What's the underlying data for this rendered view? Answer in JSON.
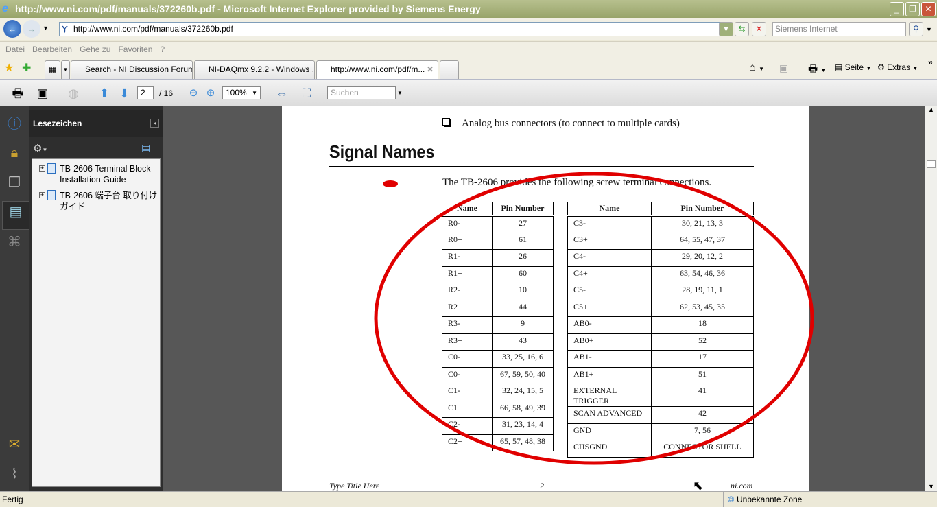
{
  "window": {
    "title": "http://www.ni.com/pdf/manuals/372260b.pdf - Microsoft Internet Explorer provided by Siemens Energy"
  },
  "address": {
    "url": "http://www.ni.com/pdf/manuals/372260b.pdf",
    "search_placeholder": "Siemens Internet"
  },
  "menu": [
    "Datei",
    "Bearbeiten",
    "Gehe zu",
    "Favoriten",
    "?"
  ],
  "tabs": [
    {
      "label": "Search - NI Discussion Forums"
    },
    {
      "label": "NI-DAQmx 9.2.2 - Windows ..."
    },
    {
      "label": "http://www.ni.com/pdf/m..."
    }
  ],
  "ie_toolbar": {
    "page": "Seite",
    "tools": "Extras"
  },
  "pdf_toolbar": {
    "page": "2",
    "total": "/ 16",
    "zoom": "100%",
    "find_placeholder": "Suchen"
  },
  "bookmarks": {
    "title": "Lesezeichen",
    "items": [
      "TB-2606 Terminal Block Installation Guide",
      "TB-2606 端子台 取り付けガイド"
    ]
  },
  "document": {
    "bullet": "Analog bus connectors (to connect to multiple cards)",
    "heading": "Signal Names",
    "intro": "The TB-2606 provides the following screw terminal connections.",
    "headers": [
      "Name",
      "Pin Number"
    ],
    "left_table": [
      [
        "R0-",
        "27"
      ],
      [
        "R0+",
        "61"
      ],
      [
        "R1-",
        "26"
      ],
      [
        "R1+",
        "60"
      ],
      [
        "R2-",
        "10"
      ],
      [
        "R2+",
        "44"
      ],
      [
        "R3-",
        "9"
      ],
      [
        "R3+",
        "43"
      ],
      [
        "C0-",
        "33, 25, 16, 6"
      ],
      [
        "C0-",
        "67, 59, 50, 40"
      ],
      [
        "C1-",
        "32, 24, 15, 5"
      ],
      [
        "C1+",
        "66, 58, 49, 39"
      ],
      [
        "C2-",
        "31, 23, 14, 4"
      ],
      [
        "C2+",
        "65, 57, 48, 38"
      ]
    ],
    "right_table": [
      [
        "C3-",
        "30, 21, 13, 3"
      ],
      [
        "C3+",
        "64, 55, 47, 37"
      ],
      [
        "C4-",
        "29, 20, 12, 2"
      ],
      [
        "C4+",
        "63, 54, 46, 36"
      ],
      [
        "C5-",
        "28, 19, 11, 1"
      ],
      [
        "C5+",
        "62, 53, 45, 35"
      ],
      [
        "AB0-",
        "18"
      ],
      [
        "AB0+",
        "52"
      ],
      [
        "AB1-",
        "17"
      ],
      [
        "AB1+",
        "51"
      ],
      [
        "EXTERNAL TRIGGER",
        "41"
      ],
      [
        "SCAN ADVANCED",
        "42"
      ],
      [
        "GND",
        "7, 56"
      ],
      [
        "CHSGND",
        "CONNECTOR SHELL"
      ]
    ],
    "footer_left": "Type Title Here",
    "footer_page": "2",
    "footer_right": "ni.com"
  },
  "status": {
    "left": "Fertig",
    "zone": "Unbekannte Zone"
  },
  "colors": {
    "annotation": "#e00000"
  }
}
